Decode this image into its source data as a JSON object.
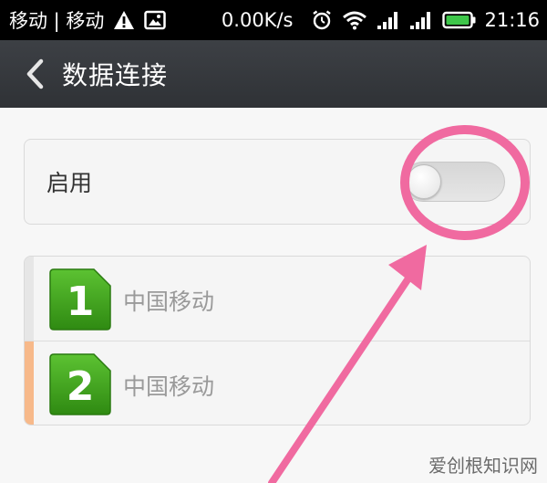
{
  "status_bar": {
    "carrier": "移动 | 移动",
    "speed": "0.00K/s",
    "time": "21:16",
    "icons": [
      "warning-icon",
      "image-icon",
      "alarm-icon",
      "wifi-icon",
      "signal-icon",
      "signal-icon",
      "battery-icon"
    ],
    "battery_color": "#3ec64a"
  },
  "title_bar": {
    "title": "数据连接",
    "background": "#34373b"
  },
  "enable_row": {
    "label": "启用",
    "toggle_on": false
  },
  "sims": [
    {
      "slot": "1",
      "name": "中国移动",
      "badge_color": "#3a9c1a"
    },
    {
      "slot": "2",
      "name": "中国移动",
      "badge_color": "#3a9c1a"
    }
  ],
  "annotation": {
    "color": "#f06aa0"
  },
  "watermark": {
    "text": "爱创根知识网"
  }
}
